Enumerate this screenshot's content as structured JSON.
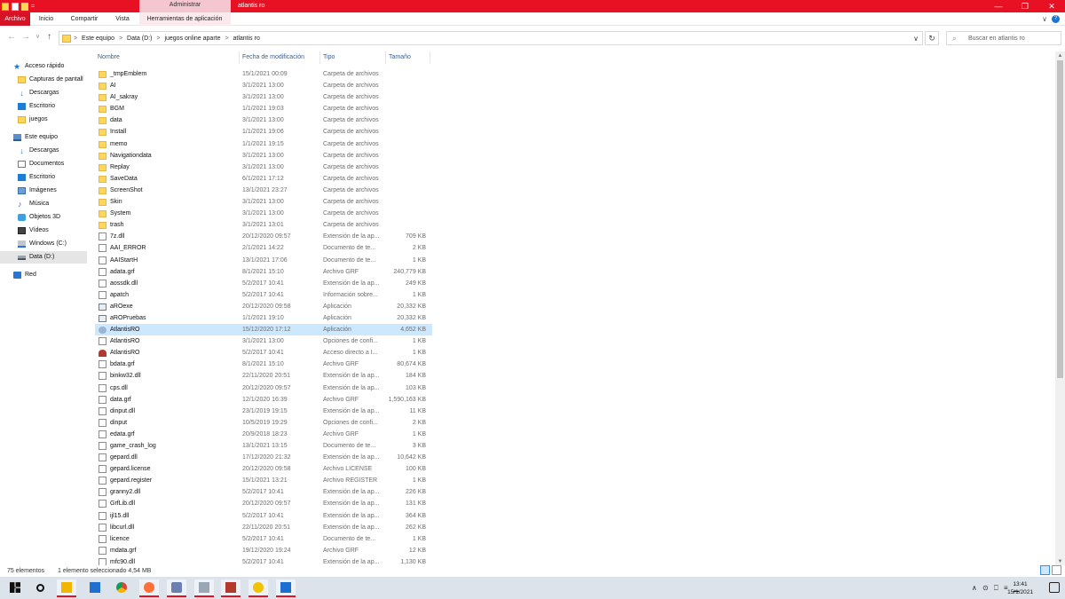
{
  "window": {
    "contextual_tab": "Administrar",
    "title": "atlantis ro",
    "controls": {
      "minimize": "—",
      "maximize": "❐",
      "close": "✕"
    }
  },
  "ribbon": {
    "tabs": [
      "Archivo",
      "Inicio",
      "Compartir",
      "Vista",
      "Herramientas de aplicación"
    ],
    "chevron": "∨",
    "help": "?"
  },
  "address": {
    "back": "←",
    "forward": "→",
    "recent": "∨",
    "up": "↑",
    "crumbs": [
      "Este equipo",
      "Data (D:)",
      "juegos online aparte",
      "atlantis ro"
    ],
    "sep": ">",
    "dropdown": "∨",
    "refresh": "↻",
    "search_icon": "⌕",
    "search_placeholder": "Buscar en atlantis ro"
  },
  "nav_pane": {
    "items": [
      {
        "label": "Acceso rápido",
        "icon": "star-icon",
        "glyph": "★",
        "indent": 0
      },
      {
        "label": "Capturas de pantall",
        "icon": "folder-icon",
        "indent": 1
      },
      {
        "label": "Descargas",
        "icon": "download-icon",
        "glyph": "↓",
        "indent": 1
      },
      {
        "label": "Escritorio",
        "icon": "desktop-icon",
        "indent": 1
      },
      {
        "label": "juegos",
        "icon": "folder-icon",
        "indent": 1
      },
      {
        "label": "Este equipo",
        "icon": "computer-icon",
        "indent": 0
      },
      {
        "label": "Descargas",
        "icon": "download-icon",
        "glyph": "↓",
        "indent": 1
      },
      {
        "label": "Documentos",
        "icon": "documents-icon",
        "indent": 1
      },
      {
        "label": "Escritorio",
        "icon": "desktop-icon",
        "indent": 1
      },
      {
        "label": "Imágenes",
        "icon": "pictures-icon",
        "indent": 1
      },
      {
        "label": "Música",
        "icon": "music-icon",
        "glyph": "♪",
        "indent": 1
      },
      {
        "label": "Objetos 3D",
        "icon": "objects-3d-icon",
        "indent": 1
      },
      {
        "label": "Vídeos",
        "icon": "videos-icon",
        "indent": 1
      },
      {
        "label": "Windows (C:)",
        "icon": "windows-drive-icon",
        "indent": 1
      },
      {
        "label": "Data (D:)",
        "icon": "drive-icon",
        "indent": 1,
        "selected": true
      },
      {
        "label": "Red",
        "icon": "network-icon",
        "indent": 0
      }
    ]
  },
  "file_list": {
    "columns": [
      "Nombre",
      "Fecha de modificación",
      "Tipo",
      "Tamaño"
    ],
    "sort_arrow": "^",
    "rows": [
      {
        "name": "_tmpEmblem",
        "date": "15/1/2021 00:09",
        "type": "Carpeta de archivos",
        "size": "",
        "icon": "folder"
      },
      {
        "name": "AI",
        "date": "3/1/2021 13:00",
        "type": "Carpeta de archivos",
        "size": "",
        "icon": "folder"
      },
      {
        "name": "AI_sakray",
        "date": "3/1/2021 13:00",
        "type": "Carpeta de archivos",
        "size": "",
        "icon": "folder"
      },
      {
        "name": "BGM",
        "date": "1/1/2021 19:03",
        "type": "Carpeta de archivos",
        "size": "",
        "icon": "folder"
      },
      {
        "name": "data",
        "date": "3/1/2021 13:00",
        "type": "Carpeta de archivos",
        "size": "",
        "icon": "folder"
      },
      {
        "name": "Install",
        "date": "1/1/2021 19:06",
        "type": "Carpeta de archivos",
        "size": "",
        "icon": "folder"
      },
      {
        "name": "memo",
        "date": "1/1/2021 19:15",
        "type": "Carpeta de archivos",
        "size": "",
        "icon": "folder"
      },
      {
        "name": "Navigationdata",
        "date": "3/1/2021 13:00",
        "type": "Carpeta de archivos",
        "size": "",
        "icon": "folder"
      },
      {
        "name": "Replay",
        "date": "3/1/2021 13:00",
        "type": "Carpeta de archivos",
        "size": "",
        "icon": "folder"
      },
      {
        "name": "SaveData",
        "date": "6/1/2021 17:12",
        "type": "Carpeta de archivos",
        "size": "",
        "icon": "folder"
      },
      {
        "name": "ScreenShot",
        "date": "13/1/2021 23:27",
        "type": "Carpeta de archivos",
        "size": "",
        "icon": "folder"
      },
      {
        "name": "Skin",
        "date": "3/1/2021 13:00",
        "type": "Carpeta de archivos",
        "size": "",
        "icon": "folder"
      },
      {
        "name": "System",
        "date": "3/1/2021 13:00",
        "type": "Carpeta de archivos",
        "size": "",
        "icon": "folder"
      },
      {
        "name": "trash",
        "date": "3/1/2021 13:01",
        "type": "Carpeta de archivos",
        "size": "",
        "icon": "folder"
      },
      {
        "name": "7z.dll",
        "date": "20/12/2020 09:57",
        "type": "Extensión de la ap...",
        "size": "709 KB",
        "icon": "file"
      },
      {
        "name": "AAI_ERROR",
        "date": "2/1/2021 14:22",
        "type": "Documento de te...",
        "size": "2 KB",
        "icon": "file"
      },
      {
        "name": "AAIStartH",
        "date": "13/1/2021 17:06",
        "type": "Documento de te...",
        "size": "1 KB",
        "icon": "file"
      },
      {
        "name": "adata.grf",
        "date": "8/1/2021 15:10",
        "type": "Archivo GRF",
        "size": "240,779 KB",
        "icon": "file"
      },
      {
        "name": "aossdk.dll",
        "date": "5/2/2017 10:41",
        "type": "Extensión de la ap...",
        "size": "249 KB",
        "icon": "file"
      },
      {
        "name": "apatch",
        "date": "5/2/2017 10:41",
        "type": "Información sobre...",
        "size": "1 KB",
        "icon": "file"
      },
      {
        "name": "aROexe",
        "date": "20/12/2020 09:58",
        "type": "Aplicación",
        "size": "20,332 KB",
        "icon": "exe"
      },
      {
        "name": "aROPruebas",
        "date": "1/1/2021 19:10",
        "type": "Aplicación",
        "size": "20,332 KB",
        "icon": "exe"
      },
      {
        "name": "AtlantisRO",
        "date": "15/12/2020 17:12",
        "type": "Aplicación",
        "size": "4,652 KB",
        "icon": "aro",
        "selected": true
      },
      {
        "name": "AtlantisRO",
        "date": "3/1/2021 13:00",
        "type": "Opciones de confi...",
        "size": "1 KB",
        "icon": "file"
      },
      {
        "name": "AtlantisRO",
        "date": "5/2/2017 10:41",
        "type": "Acceso directo a I...",
        "size": "1 KB",
        "icon": "atl"
      },
      {
        "name": "bdata.grf",
        "date": "8/1/2021 15:10",
        "type": "Archivo GRF",
        "size": "80,674 KB",
        "icon": "file"
      },
      {
        "name": "binkw32.dll",
        "date": "22/11/2020 20:51",
        "type": "Extensión de la ap...",
        "size": "184 KB",
        "icon": "file"
      },
      {
        "name": "cps.dll",
        "date": "20/12/2020 09:57",
        "type": "Extensión de la ap...",
        "size": "103 KB",
        "icon": "file"
      },
      {
        "name": "data.grf",
        "date": "12/1/2020 16:39",
        "type": "Archivo GRF",
        "size": "1,590,163 KB",
        "icon": "file"
      },
      {
        "name": "dinput.dll",
        "date": "23/1/2019 19:15",
        "type": "Extensión de la ap...",
        "size": "11 KB",
        "icon": "file"
      },
      {
        "name": "dinput",
        "date": "10/5/2019 19:29",
        "type": "Opciones de confi...",
        "size": "2 KB",
        "icon": "file"
      },
      {
        "name": "edata.grf",
        "date": "20/9/2018 18:23",
        "type": "Archivo GRF",
        "size": "1 KB",
        "icon": "file"
      },
      {
        "name": "game_crash_log",
        "date": "13/1/2021 13:15",
        "type": "Documento de te...",
        "size": "3 KB",
        "icon": "file"
      },
      {
        "name": "gepard.dll",
        "date": "17/12/2020 21:32",
        "type": "Extensión de la ap...",
        "size": "10,642 KB",
        "icon": "file"
      },
      {
        "name": "gepard.license",
        "date": "20/12/2020 09:58",
        "type": "Archivo LICENSE",
        "size": "100 KB",
        "icon": "file"
      },
      {
        "name": "gepard.register",
        "date": "15/1/2021 13:21",
        "type": "Archivo REGISTER",
        "size": "1 KB",
        "icon": "file"
      },
      {
        "name": "granny2.dll",
        "date": "5/2/2017 10:41",
        "type": "Extensión de la ap...",
        "size": "226 KB",
        "icon": "file"
      },
      {
        "name": "GrfLib.dll",
        "date": "20/12/2020 09:57",
        "type": "Extensión de la ap...",
        "size": "131 KB",
        "icon": "file"
      },
      {
        "name": "ijl15.dll",
        "date": "5/2/2017 10:41",
        "type": "Extensión de la ap...",
        "size": "364 KB",
        "icon": "file"
      },
      {
        "name": "libcurl.dll",
        "date": "22/11/2020 20:51",
        "type": "Extensión de la ap...",
        "size": "262 KB",
        "icon": "file"
      },
      {
        "name": "licence",
        "date": "5/2/2017 10:41",
        "type": "Documento de te...",
        "size": "1 KB",
        "icon": "file"
      },
      {
        "name": "mdata.grf",
        "date": "19/12/2020 19:24",
        "type": "Archivo GRF",
        "size": "12 KB",
        "icon": "file"
      },
      {
        "name": "mfc90.dll",
        "date": "5/2/2017 10:41",
        "type": "Extensión de la ap...",
        "size": "1,130 KB",
        "icon": "file"
      }
    ]
  },
  "status": {
    "count": "75 elementos",
    "selection": "1 elemento seleccionado  4,54 MB"
  },
  "scrollbar": {
    "up": "▲",
    "down": "▼",
    "position_fraction": 0.0,
    "visible_fraction": 0.64
  },
  "taskbar": {
    "apps": [
      "start-icon",
      "search-icon",
      "file-explorer-icon",
      "mail-icon",
      "chrome-icon",
      "firefox-icon",
      "app-icon",
      "photos-icon",
      "game-icon",
      "xbox-icon",
      "media-icon"
    ],
    "tray_icons": "∧ ⊙ ⎕ ≡ ▁",
    "time": "13:41",
    "date": "15/1/2021"
  }
}
